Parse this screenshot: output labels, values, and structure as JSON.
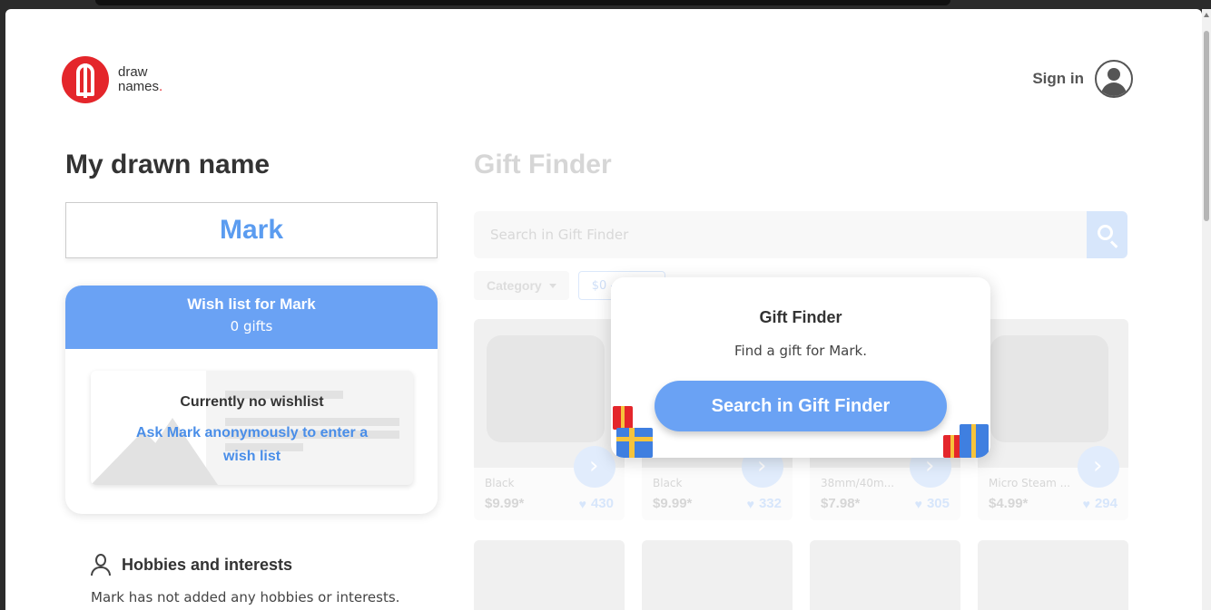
{
  "header": {
    "logo_line1": "draw",
    "logo_line2": "names",
    "logo_dot": ".",
    "signin_label": "Sign in"
  },
  "drawn": {
    "title": "My drawn name",
    "name": "Mark"
  },
  "wishlist": {
    "title": "Wish list for Mark",
    "count": "0 gifts",
    "empty_title": "Currently no wishlist",
    "ask_link": "Ask Mark anonymously to enter a wish list"
  },
  "hobbies": {
    "title": "Hobbies and interests",
    "text": "Mark has not added any hobbies or interests."
  },
  "gift_finder": {
    "title": "Gift Finder",
    "search_placeholder": "Search in Gift Finder",
    "filter_category": "Category",
    "filter_price": "$0 - ...",
    "products": [
      {
        "sub": "Black",
        "price": "$9.99*",
        "likes": "430"
      },
      {
        "sub": "Black",
        "price": "$9.99*",
        "likes": "332"
      },
      {
        "sub": "38mm/40m...",
        "price": "$7.98*",
        "likes": "305"
      },
      {
        "sub": "Micro Steam ...",
        "price": "$4.99*",
        "likes": "294"
      }
    ]
  },
  "modal": {
    "title": "Gift Finder",
    "text": "Find a gift for Mark.",
    "button": "Search in Gift Finder"
  },
  "colors": {
    "accent": "#6aa2f4",
    "brand_red": "#e4262b"
  },
  "icons": [
    "logo-icon",
    "user-avatar-icon",
    "search-icon",
    "chevron-down-icon",
    "person-icon",
    "heart-icon",
    "chevron-right-icon",
    "gift-icon"
  ]
}
